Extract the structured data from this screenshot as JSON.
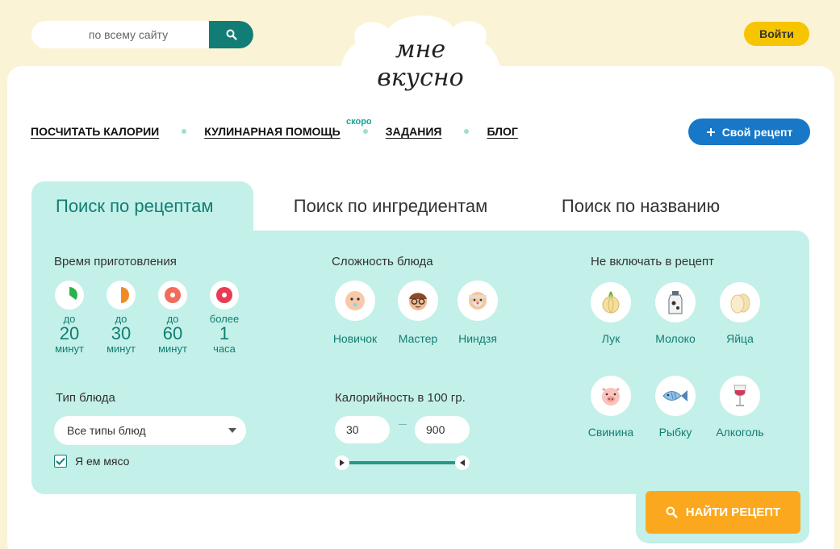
{
  "search": {
    "placeholder": "по всему сайту"
  },
  "header": {
    "login_label": "Войти",
    "logo_text": "МНЕ ВКУСНО"
  },
  "nav": {
    "items": [
      {
        "label": "ПОСЧИТАТЬ КАЛОРИИ"
      },
      {
        "label": "КУЛИНАРНАЯ ПОМОЩЬ"
      },
      {
        "label": "ЗАДАНИЯ"
      },
      {
        "label": "БЛОГ"
      }
    ],
    "soon_label": "скоро",
    "add_recipe_label": "Свой рецепт"
  },
  "tabs": [
    {
      "label": "Поиск по рецептам",
      "active": true
    },
    {
      "label": "Поиск по ингредиентам",
      "active": false
    },
    {
      "label": "Поиск по названию",
      "active": false
    }
  ],
  "time": {
    "title": "Время приготовления",
    "options": [
      {
        "pre": "до",
        "num": "20",
        "unit": "минут",
        "color": "#2bb24c"
      },
      {
        "pre": "до",
        "num": "30",
        "unit": "минут",
        "color": "#f08a24"
      },
      {
        "pre": "до",
        "num": "60",
        "unit": "минут",
        "color": "#f26b5b"
      },
      {
        "pre": "более",
        "num": "1",
        "unit": "часа",
        "color": "#ea3b54"
      }
    ]
  },
  "difficulty": {
    "title": "Сложность блюда",
    "options": [
      {
        "label": "Новичок",
        "icon": "baby-face-icon"
      },
      {
        "label": "Мастер",
        "icon": "glasses-man-icon"
      },
      {
        "label": "Ниндзя",
        "icon": "old-master-icon"
      }
    ]
  },
  "exclude": {
    "title": "Не включать в рецепт",
    "options": [
      {
        "label": "Лук",
        "icon": "onion-icon"
      },
      {
        "label": "Молоко",
        "icon": "milk-icon"
      },
      {
        "label": "Яйца",
        "icon": "eggs-icon"
      },
      {
        "label": "Свинина",
        "icon": "pig-icon"
      },
      {
        "label": "Рыбку",
        "icon": "fish-icon"
      },
      {
        "label": "Алкоголь",
        "icon": "wine-glass-icon"
      }
    ]
  },
  "dish_type": {
    "title": "Тип блюда",
    "selected": "Все типы блюд",
    "meat_label": "Я ем мясо",
    "meat_checked": true
  },
  "calories": {
    "title": "Калорийность в 100 гр.",
    "min": "30",
    "max": "900"
  },
  "find_label": "НАЙТИ РЕЦЕПТ",
  "colors": {
    "accent": "#127d74",
    "panel": "#c3f0e8",
    "cta": "#fba81e",
    "blue": "#1778c8",
    "yellow": "#f7c400"
  }
}
